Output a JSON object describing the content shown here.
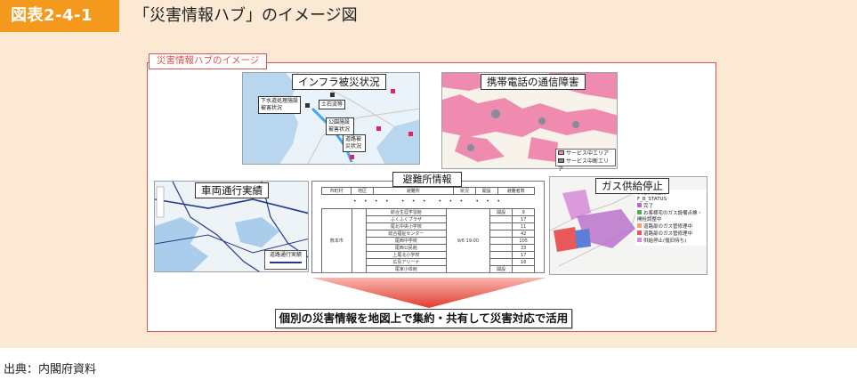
{
  "figure": {
    "number_label": "図表2-4-1",
    "title": "「災害情報ハブ」のイメージ図"
  },
  "frame": {
    "tab_label": "災害情報ハブのイメージ"
  },
  "panels": {
    "infrastructure": {
      "title": "インフラ被災状況",
      "labels": [
        "下水道処理施設被害状況",
        "土石流等",
        "公園施設被害状況",
        "道路被災状況"
      ]
    },
    "mobile": {
      "title": "携帯電話の通信障害",
      "legend": [
        "サービス中エリア",
        "サービス中断エリア"
      ],
      "legend_colors": [
        "#f08bb0",
        "#7f7f9f"
      ]
    },
    "vehicle": {
      "title": "車両通行実績",
      "legend": "道路通行実績"
    },
    "shelter": {
      "title": "避難所情報",
      "headers": [
        "市町村",
        "地区",
        "避難所",
        "状況",
        "開設",
        "避難者数"
      ],
      "ellipsis": "・・・・ ・・・ ・・・ ・・・",
      "city": "熊本市",
      "time": "9/6 19:00",
      "rows": [
        {
          "name": "総合生涯学習館",
          "open": "開設",
          "count": "9"
        },
        {
          "name": "ふくふくプラザ",
          "open": "",
          "count": "17"
        },
        {
          "name": "尾北中央小学校",
          "open": "",
          "count": "11"
        },
        {
          "name": "総合福祉センター",
          "open": "",
          "count": "42"
        },
        {
          "name": "尾西中学校",
          "open": "",
          "count": "105"
        },
        {
          "name": "尾西公民館",
          "open": "",
          "count": "33"
        },
        {
          "name": "上尾北小学校",
          "open": "",
          "count": "17"
        },
        {
          "name": "広島アリーナ",
          "open": "",
          "count": "16"
        },
        {
          "name": "尾家小体館",
          "open": "開設",
          "count": ""
        }
      ]
    },
    "gas": {
      "title": "ガス供給停止",
      "legend_title": "供給状況区分",
      "legend_subtitle": "F_B_STATUS",
      "legend": [
        "完了",
        "お客様宅のガス設備点検・開栓調整中",
        "道路部のガス管修理中",
        "道路部のガス管修理中",
        "供給停止(復旧待ち)"
      ],
      "legend_colors": [
        "#b66cc9",
        "#4caf50",
        "#f3a66a",
        "#e85a5a",
        "#d68ad8"
      ]
    },
    "result": {
      "text": "個別の災害情報を地図上で集約・共有して災害対応で活用"
    }
  },
  "source": {
    "text": "出典：内閣府資料"
  }
}
